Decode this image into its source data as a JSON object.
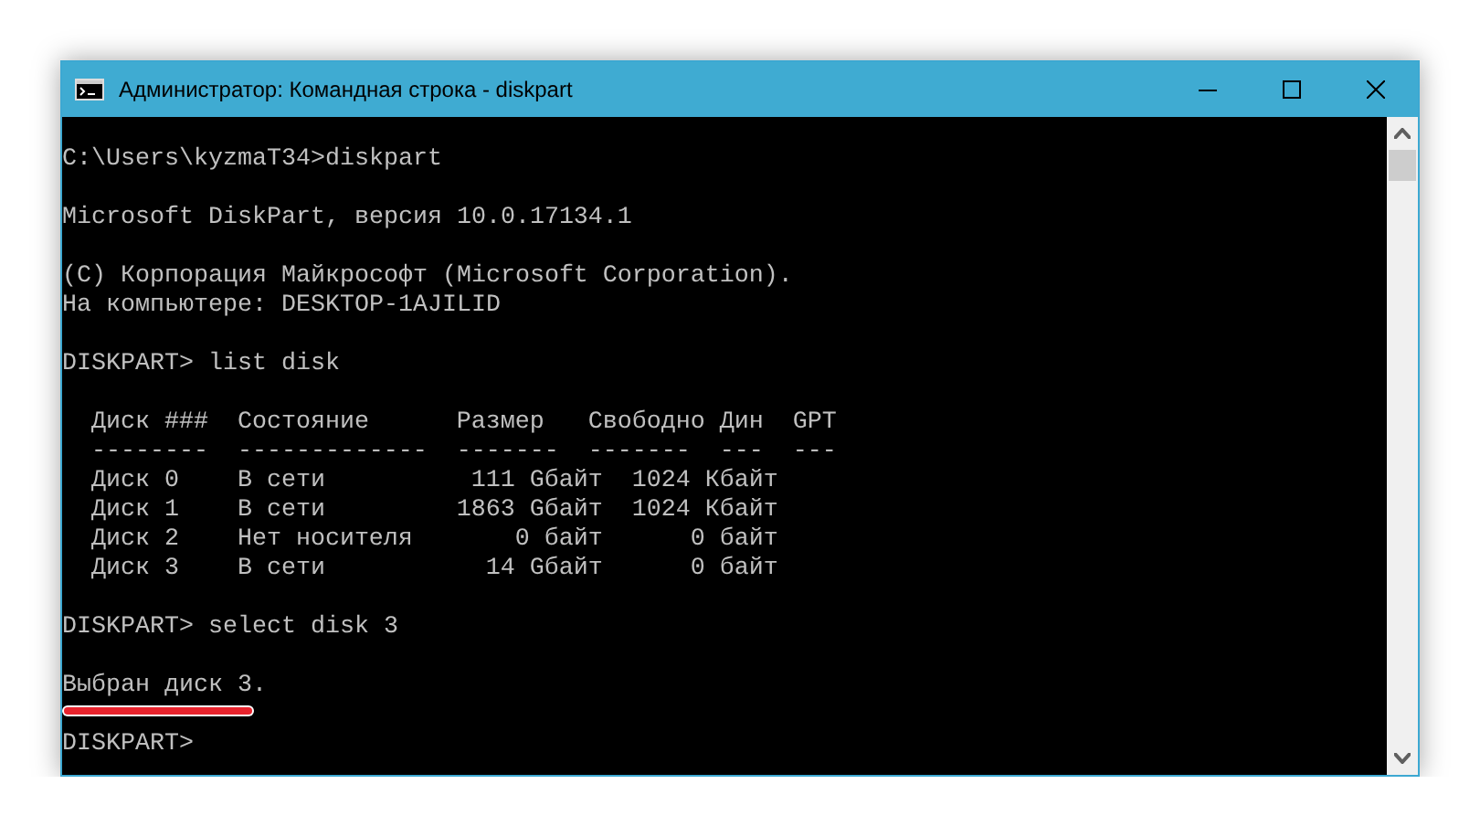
{
  "window": {
    "title": "Администратор: Командная строка - diskpart"
  },
  "console": {
    "blocks": [
      {
        "kind": "lines",
        "lines": [
          {
            "text": "C:\\Users\\kyzmaT34>diskpart"
          }
        ]
      },
      {
        "kind": "lines",
        "lines": [
          {
            "text": "Microsoft DiskPart, версия 10.0.17134.1"
          }
        ]
      },
      {
        "kind": "lines",
        "lines": [
          {
            "text": "(C) Корпорация Майкрософт (Microsoft Corporation)."
          },
          {
            "text": "На компьютере: DESKTOP-1AJILID"
          }
        ]
      },
      {
        "kind": "lines",
        "lines": [
          {
            "text": "DISKPART> list disk"
          }
        ]
      },
      {
        "kind": "table",
        "rows": [
          {
            "kind": "header",
            "cells": [
              "Диск ###",
              "Состояние",
              "Размер",
              "Свободно",
              "Дин",
              "GPT"
            ]
          },
          {
            "kind": "rule",
            "cells": [
              "--------",
              "-------------",
              "-------",
              "-------",
              "---",
              "---"
            ]
          },
          {
            "kind": "data",
            "cells": [
              "Диск 0",
              "В сети",
              "111 Gбайт",
              "1024 Кбайт"
            ]
          },
          {
            "kind": "data",
            "cells": [
              "Диск 1",
              "В сети",
              "1863 Gбайт",
              "1024 Кбайт"
            ]
          },
          {
            "kind": "data",
            "cells": [
              "Диск 2",
              "Нет носителя",
              "0 байт",
              "0 байт"
            ]
          },
          {
            "kind": "data",
            "cells": [
              "Диск 3",
              "В сети",
              "14 Gбайт",
              "0 байт"
            ]
          }
        ]
      },
      {
        "kind": "lines",
        "lines": [
          {
            "text": "DISKPART> select disk 3"
          }
        ]
      },
      {
        "kind": "lines",
        "lines": [
          {
            "text": "Выбран диск 3.",
            "underlined": true
          }
        ]
      },
      {
        "kind": "lines",
        "lines": [
          {
            "text": "DISKPART>"
          }
        ]
      }
    ]
  }
}
